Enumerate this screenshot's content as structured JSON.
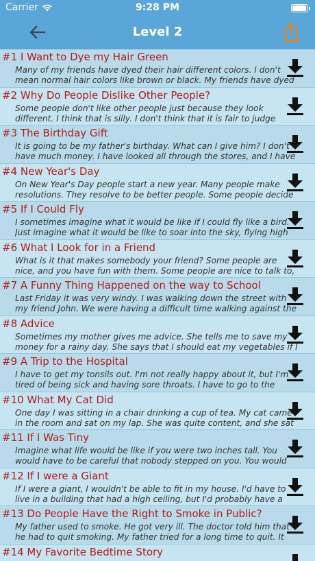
{
  "status_bar": {
    "carrier": "Carrier",
    "time": "9:28 PM"
  },
  "nav": {
    "title": "Level 2",
    "back_icon": "arrow-left-icon",
    "share_icon": "share-icon"
  },
  "colors": {
    "bar": "#5aa6d8",
    "title_red": "#b01c18",
    "row_odd": "#b8daea",
    "row_even": "#c6e4f1"
  },
  "stories": [
    {
      "title": "#1 I Want to Dye my Hair Green",
      "excerpt": "Many of my friends have dyed their hair different colors. I don't mean normal hair colors like brown or black. My friends have dyed their hair"
    },
    {
      "title": "#2 Why Do People Dislike Other People?",
      "excerpt": "Some people don't like other people just because they look different. I think that is silly. I don't think that it is fair to judge someone by the way"
    },
    {
      "title": "#3 The Birthday Gift",
      "excerpt": "It is going to be my father's birthday. What can I give him? I don't have much money. I have looked all through the stores, and I have not found"
    },
    {
      "title": "#4 New Year's Day",
      "excerpt": "On New Year's Day people start a new year. Many people make resolutions. They resolve to be better people. Some people decide that"
    },
    {
      "title": "#5 If I Could Fly",
      "excerpt": "I sometimes imagine what it would be like if I could fly like a bird. Just imagine what it would be like to soar into the sky, flying high above the"
    },
    {
      "title": "#6 What I Look for in a Friend",
      "excerpt": "What is it that makes somebody your friend? Some people are nice, and you have fun with them. Some people are nice to talk to, but they don't"
    },
    {
      "title": "#7 A Funny Thing Happened on the way to School",
      "excerpt": "Last Friday it was very windy. I was walking down the street with my friend John. We were having a difficult time walking against the wind. The"
    },
    {
      "title": "#8 Advice",
      "excerpt": "Sometimes my mother gives me advice. She tells me to save my money for a rainy day. She says that I should eat my vegetables if I want to be"
    },
    {
      "title": "#9 A Trip to the Hospital",
      "excerpt": "I have to get my tonsils out. I'm not really happy about it, but I'm tired of being sick and having sore throats. I have to go to the hospital two hours"
    },
    {
      "title": "#10 What My Cat Did",
      "excerpt": "One day I was sitting in a chair drinking a cup of tea. My cat came in the room and sat on my lap. She was quite content, and she sat there purring."
    },
    {
      "title": "#11 If I Was Tiny",
      "excerpt": "Imagine what life would be like if you were two inches tall. You would have to be careful that nobody stepped on you. You would have to watch"
    },
    {
      "title": "#12 If I were a Giant",
      "excerpt": "If I were a giant, I wouldn't be able to fit in my house. I'd have to live in a building that had a high ceiling, but I'd probably have a hard time getting"
    },
    {
      "title": "#13 Do People Have the Right to Smoke in Public?",
      "excerpt": "My father used to smoke. He got very ill. The doctor told him that he had to quit smoking. My father tried for a long time to quit. It was very"
    },
    {
      "title": "#14 My Favorite Bedtime Story",
      "excerpt": ""
    }
  ]
}
